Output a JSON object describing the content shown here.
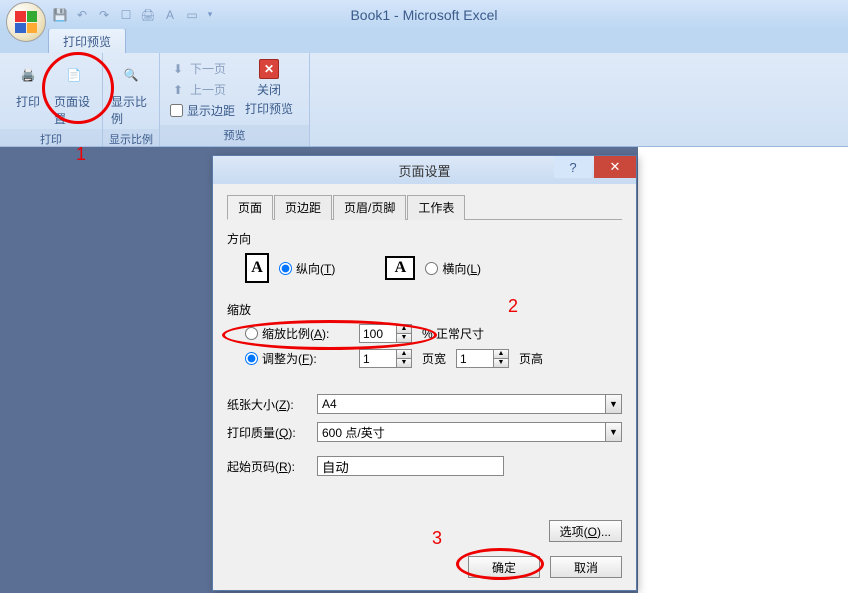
{
  "app_title": "Book1 - Microsoft Excel",
  "ribbon_tab": "打印预览",
  "ribbon": {
    "group_print": "打印",
    "group_zoom": "显示比例",
    "group_preview": "预览",
    "btn_print": "打印",
    "btn_pagesetup": "页面设置",
    "btn_zoom": "显示比例",
    "btn_nextpage": "下一页",
    "btn_prevpage": "上一页",
    "chk_margins": "显示边距",
    "btn_close_preview_l1": "关闭",
    "btn_close_preview_l2": "打印预览"
  },
  "annotations": {
    "a1": "1",
    "a2": "2",
    "a3": "3"
  },
  "dialog": {
    "title": "页面设置",
    "help": "?",
    "close": "✕",
    "tabs": {
      "page": "页面",
      "margins": "页边距",
      "headerfooter": "页眉/页脚",
      "sheet": "工作表"
    },
    "orientation": {
      "label": "方向",
      "portrait": "纵向(",
      "portrait_u": "T",
      "portrait_end": ")",
      "landscape": "横向(",
      "landscape_u": "L",
      "landscape_end": ")"
    },
    "scaling": {
      "label": "缩放",
      "adjust": "缩放比例(",
      "adjust_u": "A",
      "adjust_end": "):",
      "adjust_value": "100",
      "adjust_suffix": "% 正常尺寸",
      "fit": "调整为(",
      "fit_u": "F",
      "fit_end": "):",
      "fit_wide_value": "1",
      "fit_wide_suffix": "页宽",
      "fit_tall_value": "1",
      "fit_tall_suffix": "页高"
    },
    "paper": {
      "label_pre": "纸张大小(",
      "label_u": "Z",
      "label_end": "):",
      "value": "A4"
    },
    "quality": {
      "label_pre": "打印质量(",
      "label_u": "Q",
      "label_end": "):",
      "value": "600 点/英寸"
    },
    "firstpage": {
      "label_pre": "起始页码(",
      "label_u": "R",
      "label_end": "):",
      "value": "自动"
    },
    "options": {
      "pre": "选项(",
      "u": "O",
      "end": ")..."
    },
    "ok": "确定",
    "cancel": "取消"
  }
}
